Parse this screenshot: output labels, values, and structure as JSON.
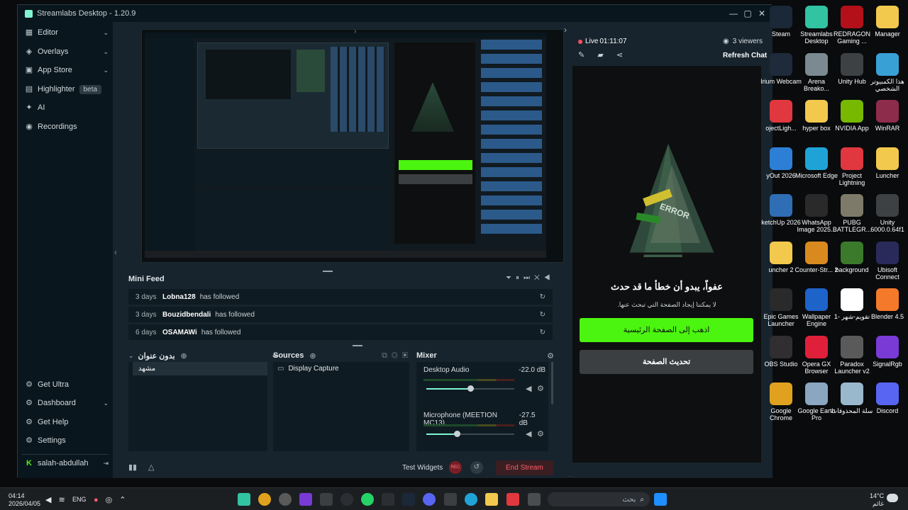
{
  "window": {
    "title": "Streamlabs Desktop - 1.20.9",
    "controls": [
      "—",
      "▢",
      "✕"
    ]
  },
  "sidebar": {
    "items": [
      {
        "label": "Editor",
        "icon": "editor-icon",
        "chevron": "⌄"
      },
      {
        "label": "Overlays",
        "icon": "overlays-icon",
        "chevron": "⌄"
      },
      {
        "label": "App Store",
        "icon": "store-icon",
        "chevron": "⌄"
      },
      {
        "label": "Highlighter",
        "icon": "highlighter-icon",
        "badge": "beta"
      },
      {
        "label": "AI",
        "icon": "ai-icon"
      },
      {
        "label": "Recordings",
        "icon": "recordings-icon"
      }
    ],
    "bottom": [
      {
        "label": "Get Ultra",
        "icon": "ultra-icon"
      },
      {
        "label": "Dashboard",
        "icon": "dashboard-icon",
        "chevron": "⌄"
      },
      {
        "label": "Get Help",
        "icon": "help-icon"
      },
      {
        "label": "Settings",
        "icon": "settings-icon"
      }
    ],
    "user": "salah-abdullah"
  },
  "mini_feed": {
    "title": "Mini Feed",
    "rows": [
      {
        "age": "3 days",
        "user": "Lobna128",
        "action": "has followed"
      },
      {
        "age": "3 days",
        "user": "Bouzidbendali",
        "action": "has followed"
      },
      {
        "age": "6 days",
        "user": "OSAMAWi",
        "action": "has followed"
      }
    ]
  },
  "scenes": {
    "title": "بدون عنوان",
    "items": [
      "مشهد"
    ]
  },
  "sources": {
    "title": "Sources",
    "items": [
      "Display Capture"
    ]
  },
  "mixer": {
    "title": "Mixer",
    "channels": [
      {
        "name": "Desktop Audio",
        "db": "-22.0 dB",
        "level": 0.5
      },
      {
        "name": "Microphone (MEETION MC13)",
        "db": "-27.5 dB",
        "level": 0.35
      }
    ]
  },
  "bottom_bar": {
    "test_widgets": "Test Widgets",
    "rec": "REC",
    "end_stream": "End Stream"
  },
  "chat": {
    "live": "Live",
    "time": "01:11:07",
    "viewers": "3 viewers",
    "refresh": "Refresh Chat",
    "error_title": "عفواً، يبدو أن خطأ ما قد حدث",
    "error_sub": "لا يمكننا إيجاد الصفحة التي تبحث عنها.",
    "home_button": "اذهب إلى الصفحة الرئيسية",
    "reload_button": "تحديث الصفحة",
    "sign_text": "ERROR"
  },
  "desktop_icons": [
    {
      "label": "Steam",
      "color": "#1b2838"
    },
    {
      "label": "Streamlabs Desktop",
      "color": "#31c3a2"
    },
    {
      "label": "REDRAGON Gaming ...",
      "color": "#b3101a"
    },
    {
      "label": "Manager",
      "color": "#f2c94c"
    },
    {
      "label": "Irium Webcam",
      "color": "#1f2a3a"
    },
    {
      "label": "Arena Breako...",
      "color": "#7a8a90"
    },
    {
      "label": "Unity Hub",
      "color": "#3d4144"
    },
    {
      "label": "هذا الكمبيوتر الشخصي",
      "color": "#39a0d6"
    },
    {
      "label": "ojectLigh...",
      "color": "#e0383e"
    },
    {
      "label": "hyper box",
      "color": "#f2c94c"
    },
    {
      "label": "NVIDIA App",
      "color": "#76b900"
    },
    {
      "label": "WinRAR",
      "color": "#8e2c4b"
    },
    {
      "label": "yOut 2026",
      "color": "#2d7fd6"
    },
    {
      "label": "Microsoft Edge",
      "color": "#1fa3d6"
    },
    {
      "label": "Project Lightning",
      "color": "#e0383e"
    },
    {
      "label": "Luncher",
      "color": "#f2c94c"
    },
    {
      "label": "ketchUp 2026",
      "color": "#2f6db5"
    },
    {
      "label": "WhatsApp Image 2025...",
      "color": "#2a2a2a"
    },
    {
      "label": "PUBG BATTLEGR...",
      "color": "#7d7a6a"
    },
    {
      "label": "Unity 6000.0.64f1",
      "color": "#3d4144"
    },
    {
      "label": "uncher 2",
      "color": "#f2c94c"
    },
    {
      "label": "Counter-Str... 2",
      "color": "#d98a1e"
    },
    {
      "label": "background",
      "color": "#3a7a2a"
    },
    {
      "label": "Ubisoft Connect",
      "color": "#2a2a5a"
    },
    {
      "label": "Epic Games Launcher",
      "color": "#2a2a2a"
    },
    {
      "label": "Wallpaper Engine",
      "color": "#1e63c9"
    },
    {
      "label": "تقويم-شهر -1",
      "color": "#ffffff"
    },
    {
      "label": "Blender 4.5",
      "color": "#f5792a"
    },
    {
      "label": "OBS Studio",
      "color": "#302e31"
    },
    {
      "label": "Opera GX Browser",
      "color": "#e0203a"
    },
    {
      "label": "Paradox Launcher v2",
      "color": "#5a5a5a"
    },
    {
      "label": "SignalRgb",
      "color": "#7a3ad6"
    },
    {
      "label": "Google Chrome",
      "color": "#e0a21e"
    },
    {
      "label": "Google Earth Pro",
      "color": "#8aa6c0"
    },
    {
      "label": "سلة المحذوفات",
      "color": "#9ab8cc"
    },
    {
      "label": "Discord",
      "color": "#5865f2"
    }
  ],
  "taskbar": {
    "time": "04:14",
    "date": "2026/04/05",
    "lang": "ENG",
    "search_placeholder": "بحث",
    "weather_temp": "14°C",
    "weather_desc": "غائم"
  }
}
